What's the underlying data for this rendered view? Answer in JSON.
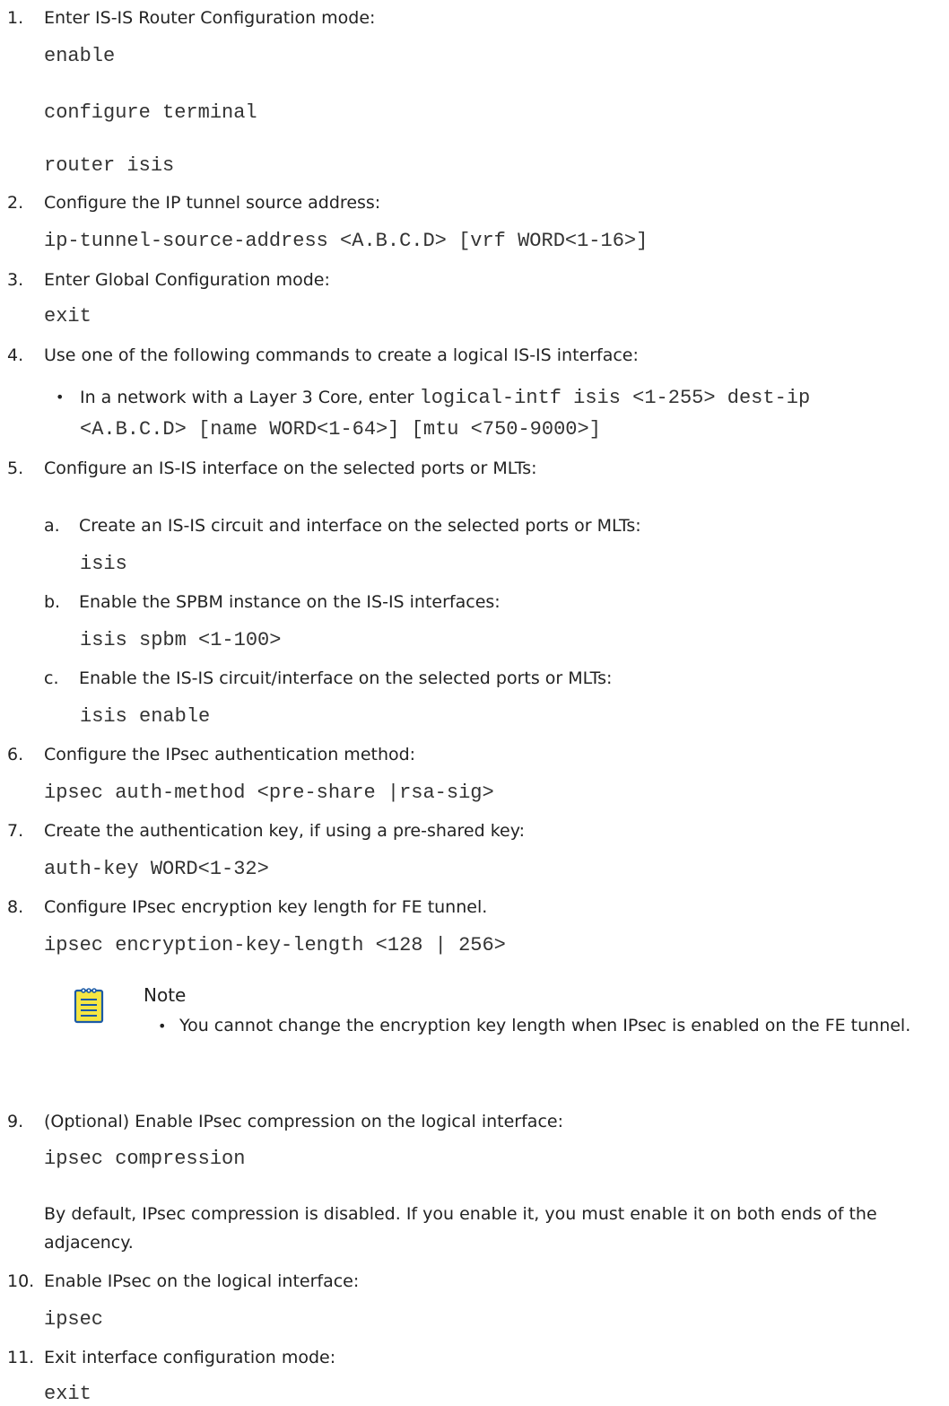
{
  "steps": [
    {
      "num": "1.",
      "text": "Enter IS-IS Router Configuration mode:",
      "commands": [
        "enable",
        "configure terminal",
        "router isis"
      ]
    },
    {
      "num": "2.",
      "text": "Configure the IP tunnel source address:",
      "command": "ip-tunnel-source-address <A.B.C.D> [vrf WORD<1-16>]"
    },
    {
      "num": "3.",
      "text": "Enter Global Configuration mode:",
      "command": "exit"
    },
    {
      "num": "4.",
      "text": "Use one of the following commands to create a logical IS-IS interface:",
      "bullet": {
        "text": "In a network with a Layer 3 Core, enter ",
        "code_line1": "logical-intf isis <1-255> dest-ip",
        "code_line2": "<A.B.C.D> [name WORD<1-64>] [mtu <750-9000>]"
      }
    },
    {
      "num": "5.",
      "text": "Configure an IS-IS interface on the selected ports or MLTs:",
      "substeps": [
        {
          "num": "a.",
          "text": "Create an IS-IS circuit and interface on the selected ports or MLTs:",
          "command": "isis"
        },
        {
          "num": "b.",
          "text": "Enable the SPBM instance on the IS-IS interfaces:",
          "command": "isis spbm <1-100>"
        },
        {
          "num": "c.",
          "text": "Enable the IS-IS circuit/interface on the selected ports or MLTs:",
          "command": "isis enable"
        }
      ]
    },
    {
      "num": "6.",
      "text": "Configure the IPsec authentication method:",
      "command": "ipsec auth-method <pre-share |rsa-sig>"
    },
    {
      "num": "7.",
      "text": "Create the authentication key, if using a pre-shared key:",
      "command": "auth-key WORD<1-32>"
    },
    {
      "num": "8.",
      "text": "Configure IPsec encryption key length for FE tunnel.",
      "command": "ipsec encryption-key-length <128 | 256>",
      "note": {
        "title": "Note",
        "text": "You cannot change the encryption key length when IPsec is enabled on the FE tunnel.",
        "icon": "note-icon",
        "icon_color": "#f5e642",
        "icon_border": "#1b5aa6"
      }
    },
    {
      "num": "9.",
      "text": "(Optional) Enable IPsec compression on the logical interface:",
      "command": "ipsec compression",
      "para_line1": "By default, IPsec compression is disabled. If you enable it, you must enable it on both ends of the",
      "para_line2": "adjacency."
    },
    {
      "num": "10.",
      "text": "Enable IPsec on the logical interface:",
      "command": "ipsec"
    },
    {
      "num": "11.",
      "text": "Exit interface configuration mode:",
      "command": "exit"
    }
  ]
}
